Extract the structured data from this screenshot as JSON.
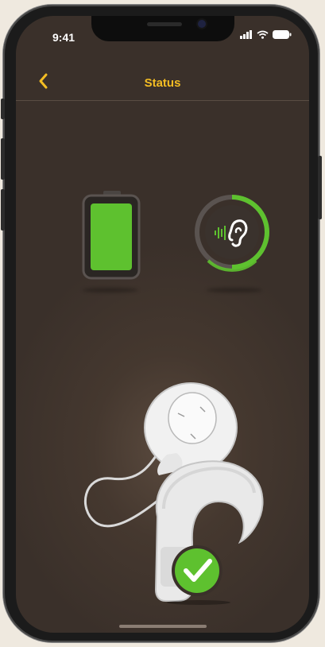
{
  "status_bar": {
    "time": "9:41"
  },
  "header": {
    "title": "Status"
  },
  "battery": {
    "level_fraction": 1.0
  },
  "hearing": {
    "ring_fraction": 0.5
  },
  "device": {
    "connected": true
  },
  "colors": {
    "accent": "#f3bd23",
    "green": "#5ec12f",
    "background": "#3a302a"
  },
  "icons": [
    "chevron-left-icon",
    "signal-icon",
    "wifi-icon",
    "battery-status-icon",
    "battery-icon",
    "ear-sound-icon",
    "sound-processor-image",
    "checkmark-icon"
  ]
}
